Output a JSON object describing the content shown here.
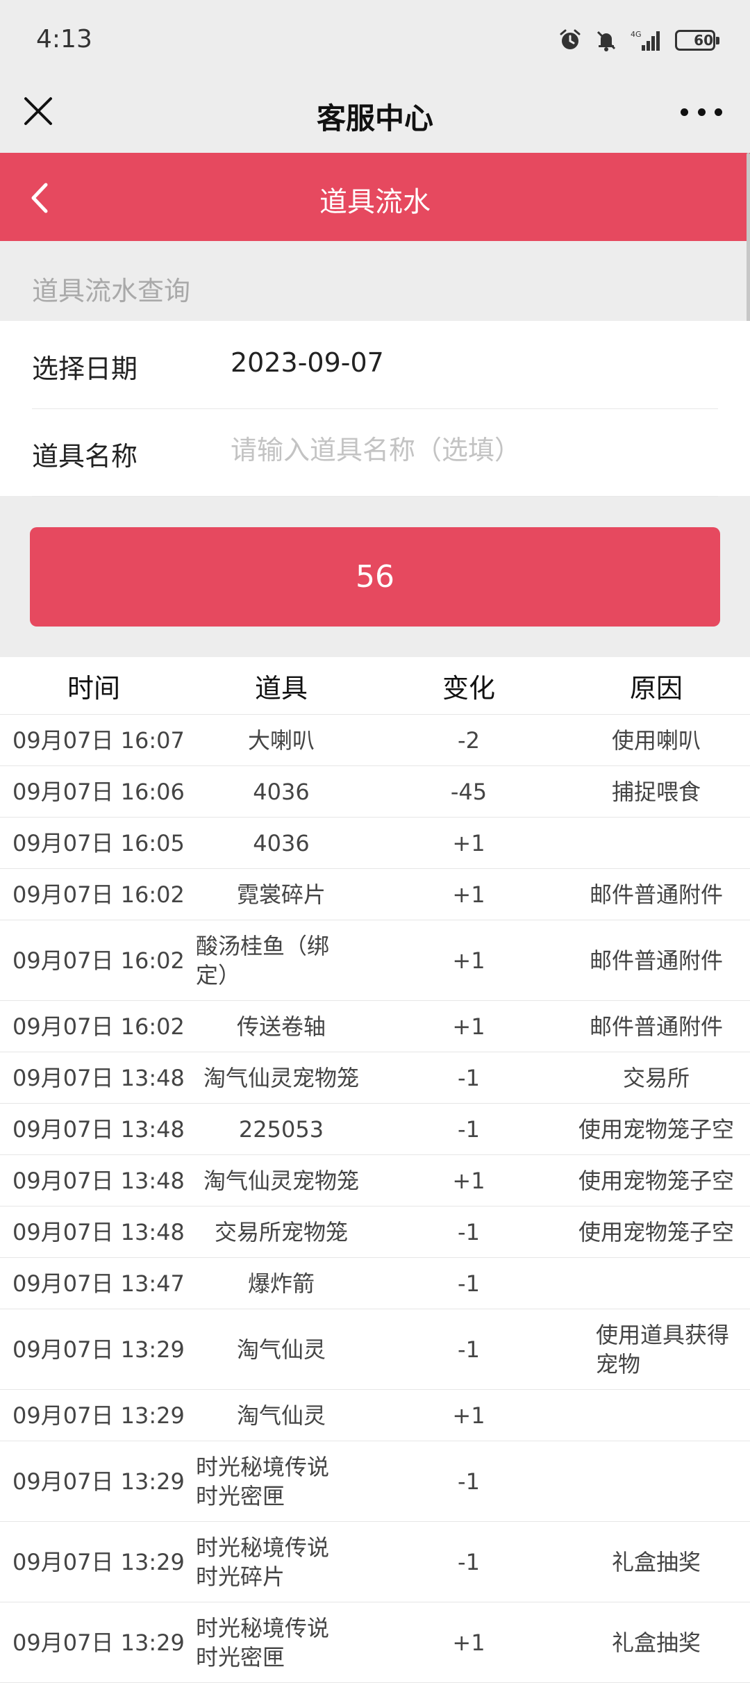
{
  "status_bar": {
    "time": "4:13",
    "battery": "60",
    "battery_level": 0.6,
    "network": "4G"
  },
  "title_bar": {
    "title": "客服中心"
  },
  "header": {
    "title": "道具流水"
  },
  "section_title": "道具流水查询",
  "form": {
    "date_label": "选择日期",
    "date_value": "2023-09-07",
    "item_label": "道具名称",
    "item_placeholder": "请输入道具名称（选填）"
  },
  "query_button": "56",
  "table": {
    "headers": [
      "时间",
      "道具",
      "变化",
      "原因"
    ],
    "rows": [
      {
        "time": "09月07日 16:07",
        "item": "大喇叭",
        "change": "-2",
        "reason": "使用喇叭"
      },
      {
        "time": "09月07日 16:06",
        "item": "4036",
        "change": "-45",
        "reason": "捕捉喂食"
      },
      {
        "time": "09月07日 16:05",
        "item": "4036",
        "change": "+1",
        "reason": ""
      },
      {
        "time": "09月07日 16:02",
        "item": "霓裳碎片",
        "change": "+1",
        "reason": "邮件普通附件"
      },
      {
        "time": "09月07日 16:02",
        "item": "酸汤桂鱼（绑定）",
        "change": "+1",
        "reason": "邮件普通附件"
      },
      {
        "time": "09月07日 16:02",
        "item": "传送卷轴",
        "change": "+1",
        "reason": "邮件普通附件"
      },
      {
        "time": "09月07日 13:48",
        "item": "淘气仙灵宠物笼",
        "change": "-1",
        "reason": "交易所"
      },
      {
        "time": "09月07日 13:48",
        "item": "225053",
        "change": "-1",
        "reason": "使用宠物笼子空"
      },
      {
        "time": "09月07日 13:48",
        "item": "淘气仙灵宠物笼",
        "change": "+1",
        "reason": "使用宠物笼子空"
      },
      {
        "time": "09月07日 13:48",
        "item": "交易所宠物笼",
        "change": "-1",
        "reason": "使用宠物笼子空"
      },
      {
        "time": "09月07日 13:47",
        "item": "爆炸箭",
        "change": "-1",
        "reason": ""
      },
      {
        "time": "09月07日 13:29",
        "item": "淘气仙灵",
        "change": "-1",
        "reason": "使用道具获得宠物"
      },
      {
        "time": "09月07日 13:29",
        "item": "淘气仙灵",
        "change": "+1",
        "reason": ""
      },
      {
        "time": "09月07日 13:29",
        "item": "时光秘境传说时光密匣",
        "change": "-1",
        "reason": ""
      },
      {
        "time": "09月07日 13:29",
        "item": "时光秘境传说时光碎片",
        "change": "-1",
        "reason": "礼盒抽奖"
      },
      {
        "time": "09月07日 13:29",
        "item": "时光秘境传说时光密匣",
        "change": "+1",
        "reason": "礼盒抽奖"
      }
    ]
  }
}
